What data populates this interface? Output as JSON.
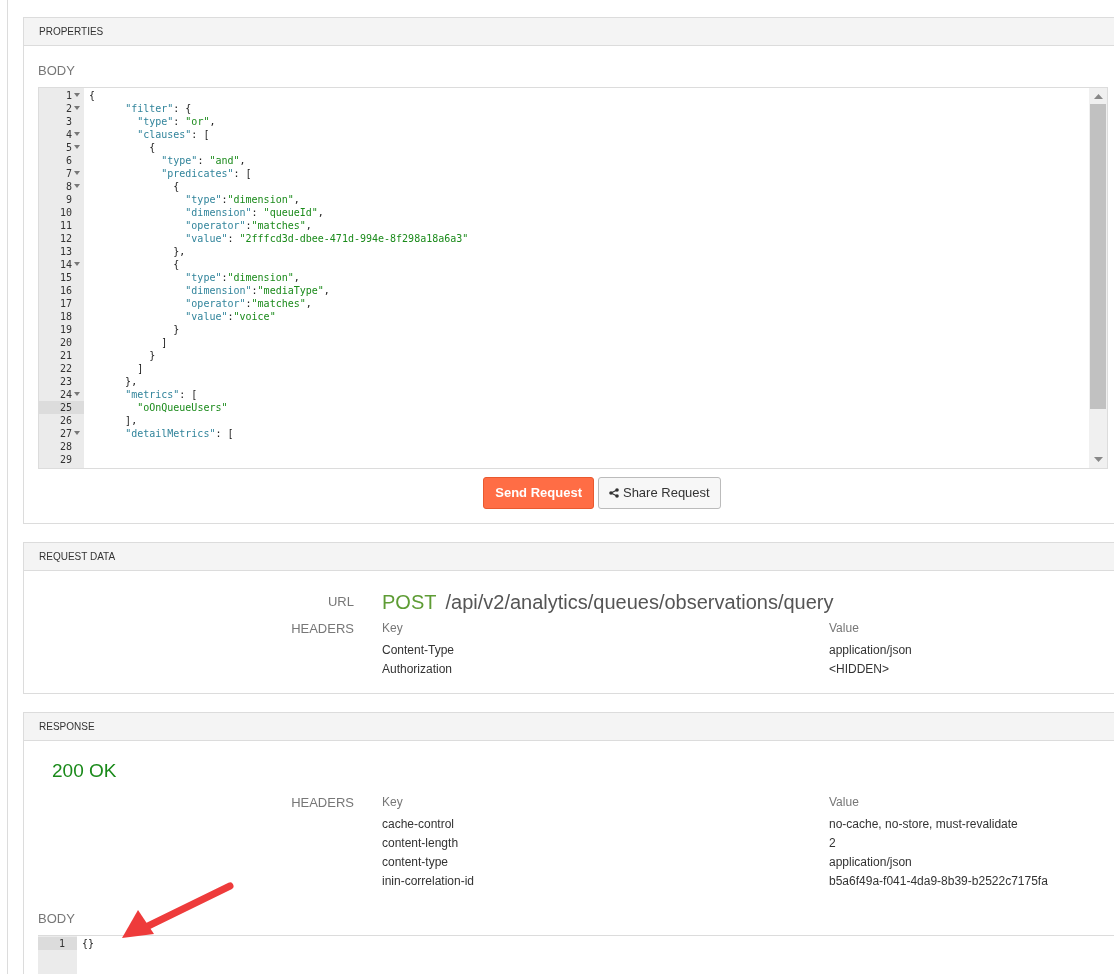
{
  "properties": {
    "title": "PROPERTIES",
    "body_label": "BODY",
    "lines": [
      {
        "number": "1",
        "foldable": true,
        "active": false,
        "text": "{"
      },
      {
        "number": "2",
        "foldable": true,
        "active": false,
        "text": "      \"filter\": {"
      },
      {
        "number": "3",
        "foldable": false,
        "active": false,
        "text": "        \"type\": \"or\","
      },
      {
        "number": "4",
        "foldable": true,
        "active": false,
        "text": "        \"clauses\": ["
      },
      {
        "number": "5",
        "foldable": true,
        "active": false,
        "text": "          {"
      },
      {
        "number": "6",
        "foldable": false,
        "active": false,
        "text": "            \"type\": \"and\","
      },
      {
        "number": "7",
        "foldable": true,
        "active": false,
        "text": "            \"predicates\": ["
      },
      {
        "number": "8",
        "foldable": true,
        "active": false,
        "text": "              {"
      },
      {
        "number": "9",
        "foldable": false,
        "active": false,
        "text": "                \"type\":\"dimension\","
      },
      {
        "number": "10",
        "foldable": false,
        "active": false,
        "text": "                \"dimension\": \"queueId\","
      },
      {
        "number": "11",
        "foldable": false,
        "active": false,
        "text": "                \"operator\":\"matches\","
      },
      {
        "number": "12",
        "foldable": false,
        "active": false,
        "text": "                \"value\": \"2fffcd3d-dbee-471d-994e-8f298a18a6a3\""
      },
      {
        "number": "13",
        "foldable": false,
        "active": false,
        "text": "              },"
      },
      {
        "number": "14",
        "foldable": true,
        "active": false,
        "text": "              {"
      },
      {
        "number": "15",
        "foldable": false,
        "active": false,
        "text": "                \"type\":\"dimension\","
      },
      {
        "number": "16",
        "foldable": false,
        "active": false,
        "text": "                \"dimension\":\"mediaType\","
      },
      {
        "number": "17",
        "foldable": false,
        "active": false,
        "text": "                \"operator\":\"matches\","
      },
      {
        "number": "18",
        "foldable": false,
        "active": false,
        "text": "                \"value\":\"voice\""
      },
      {
        "number": "19",
        "foldable": false,
        "active": false,
        "text": "              }"
      },
      {
        "number": "20",
        "foldable": false,
        "active": false,
        "text": "            ]"
      },
      {
        "number": "21",
        "foldable": false,
        "active": false,
        "text": "          }"
      },
      {
        "number": "22",
        "foldable": false,
        "active": false,
        "text": "        ]"
      },
      {
        "number": "23",
        "foldable": false,
        "active": false,
        "text": "      },"
      },
      {
        "number": "24",
        "foldable": true,
        "active": false,
        "text": "      \"metrics\": ["
      },
      {
        "number": "25",
        "foldable": false,
        "active": true,
        "text": "        \"oOnQueueUsers\""
      },
      {
        "number": "26",
        "foldable": false,
        "active": false,
        "text": "      ],"
      },
      {
        "number": "27",
        "foldable": true,
        "active": false,
        "text": "      \"detailMetrics\": ["
      },
      {
        "number": "28",
        "foldable": false,
        "active": false
      },
      {
        "number": "29",
        "foldable": false,
        "active": false
      }
    ],
    "buttons": [
      {
        "kind": "primary",
        "label": "Send Request"
      },
      {
        "kind": "share",
        "label": "Share Request"
      }
    ]
  },
  "request_data": {
    "title": "REQUEST DATA",
    "url_label": "URL",
    "method": "POST",
    "path": "/api/v2/analytics/queues/observations/query",
    "headers_label": "HEADERS",
    "key_heading": "Key",
    "value_heading": "Value",
    "headers": [
      {
        "key": "Content-Type",
        "value": "application/json"
      },
      {
        "key": "Authorization",
        "value": "<HIDDEN>"
      }
    ]
  },
  "response": {
    "title": "RESPONSE",
    "status": "200 OK",
    "headers_label": "HEADERS",
    "key_heading": "Key",
    "value_heading": "Value",
    "headers": [
      {
        "key": "cache-control",
        "value": "no-cache, no-store, must-revalidate"
      },
      {
        "key": "content-length",
        "value": "2"
      },
      {
        "key": "content-type",
        "value": "application/json"
      },
      {
        "key": "inin-correlation-id",
        "value": "b5a6f49a-f041-4da9-8b39-b2522c7175fa"
      }
    ],
    "body_label": "BODY",
    "lines": [
      {
        "number": "1",
        "foldable": false,
        "active": true,
        "text": "{}"
      }
    ]
  }
}
